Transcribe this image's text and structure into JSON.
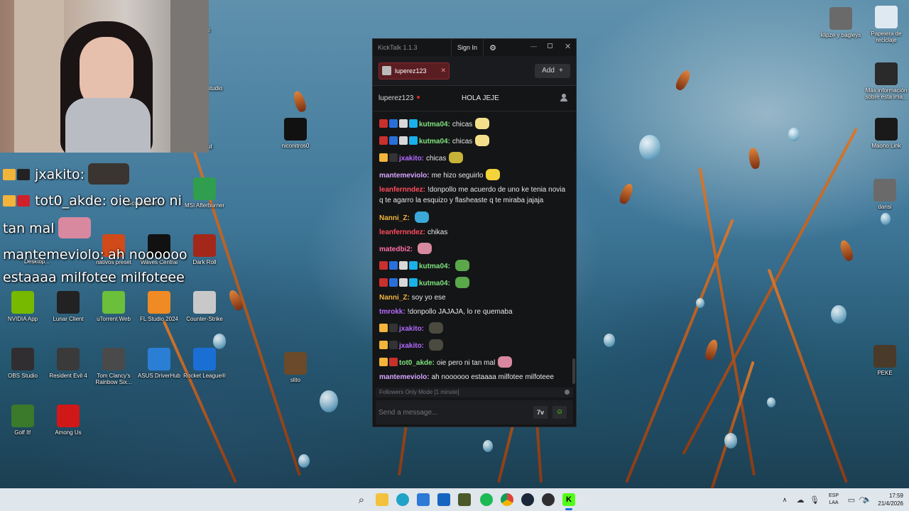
{
  "desktop": {
    "left_icons": [
      {
        "label": "MSI Afterburner",
        "color": "#2f9e4e"
      },
      {
        "label": "nativos preset",
        "color": "#d04a1a"
      },
      {
        "label": "Waves Central",
        "color": "#111111"
      },
      {
        "label": "Dark Roll",
        "color": "#a3281a"
      },
      {
        "label": "NVIDIA App",
        "color": "#76b900"
      },
      {
        "label": "Lunar Client",
        "color": "#222222"
      },
      {
        "label": "uTorrent Web",
        "color": "#6bbf3b"
      },
      {
        "label": "FL Studio 2024",
        "color": "#f08a24"
      },
      {
        "label": "Counter-Strike",
        "color": "#c8c8c8"
      },
      {
        "label": "OBS Studio",
        "color": "#302e31"
      },
      {
        "label": "Resident Evil 4",
        "color": "#3a3a3a"
      },
      {
        "label": "Tom Clancy's Rainbow Six...",
        "color": "#4a4a4a"
      },
      {
        "label": "ASUS DriverHub",
        "color": "#2a7fd4"
      },
      {
        "label": "Rocket League®",
        "color": "#1a6fd4"
      },
      {
        "label": "Golf It!",
        "color": "#3a7a2a"
      },
      {
        "label": "Among Us",
        "color": "#d01818"
      },
      {
        "label": "niconitros0",
        "color": "#111111"
      },
      {
        "label": "slito",
        "color": "#6a4a2a"
      }
    ],
    "partial_labels": [
      "lk",
      "studio",
      "ut",
      "P",
      "Screenshot 2",
      "Desktop..."
    ],
    "right_icons": [
      {
        "label": "klipze y bagleys",
        "color": "#6a6a6a"
      },
      {
        "label": "Papelera de reciclaje",
        "color": "#dfe9f2"
      },
      {
        "label": "Más información sobre esta ima...",
        "color": "#2a2a2a"
      },
      {
        "label": "Maono Link",
        "color": "#1a1a1a"
      },
      {
        "label": "dansi",
        "color": "#6a6a6a"
      },
      {
        "label": "PEKE",
        "color": "#4a3a2a"
      }
    ]
  },
  "stream_overlay": {
    "lines": [
      {
        "user": "jxakito:",
        "text": "",
        "color": "#b56bff"
      },
      {
        "user": "tot0_akde:",
        "text": "oie pero ni",
        "color": "#7ee0d0"
      },
      {
        "user": "",
        "text": "tan mal",
        "color": "#ffffff"
      },
      {
        "user": "mantemeviolo:",
        "text": "ah noooooo",
        "color": "#d7a6ff"
      },
      {
        "user": "",
        "text": "estaaaa milfotee milfoteee",
        "color": "#ffffff"
      }
    ]
  },
  "kicktalk": {
    "title": "KickTalk 1.1.3",
    "sign_in": "Sign In",
    "tab": "luperez123",
    "add_label": "Add",
    "channel": "luperez123",
    "stream_title": "HOLA JEJE",
    "followers_mode": "Followers Only Mode [1 minute]",
    "input_placeholder": "Send a message...",
    "messages": [
      {
        "user": "kutma04:",
        "text": "chicas",
        "color": "#7fe27f",
        "badges": [
          "sub",
          "mod",
          "vip",
          "gift"
        ]
      },
      {
        "user": "kutma04:",
        "text": "chicas",
        "color": "#7fe27f",
        "badges": [
          "sub",
          "mod",
          "vip",
          "gift"
        ]
      },
      {
        "user": "jxakito:",
        "text": "chicas",
        "color": "#b56bff",
        "badges": [
          "crown",
          "glasses"
        ]
      },
      {
        "user": "mantemeviolo:",
        "text": "me hizo seguirlo",
        "color": "#d7a6ff",
        "badges": []
      },
      {
        "user": "leanfernndez:",
        "text": "!donpollo me acuerdo de uno ke tenia novia q te agarro la esquizo y flasheaste q te miraba jajaja",
        "color": "#ff4d5e",
        "badges": []
      },
      {
        "user": "Nanni_Z:",
        "text": "",
        "color": "#f2b43a",
        "badges": []
      },
      {
        "user": "leanfernndez:",
        "text": "chikas",
        "color": "#ff4d5e",
        "badges": []
      },
      {
        "user": "matedbi2:",
        "text": "",
        "color": "#ff6fa8",
        "badges": []
      },
      {
        "user": "kutma04:",
        "text": "",
        "color": "#7fe27f",
        "badges": [
          "sub",
          "mod",
          "vip",
          "gift"
        ]
      },
      {
        "user": "kutma04:",
        "text": "",
        "color": "#7fe27f",
        "badges": [
          "sub",
          "mod",
          "vip",
          "gift"
        ]
      },
      {
        "user": "Nanni_Z:",
        "text": "soy yo ese",
        "color": "#f2b43a",
        "badges": []
      },
      {
        "user": "tmrokk:",
        "text": "!donpollo JAJAJA, lo re quemaba",
        "color": "#b56bff",
        "badges": []
      },
      {
        "user": "jxakito:",
        "text": "",
        "color": "#b56bff",
        "badges": [
          "crown",
          "glasses"
        ]
      },
      {
        "user": "jxakito:",
        "text": "",
        "color": "#b56bff",
        "badges": [
          "crown",
          "glasses"
        ]
      },
      {
        "user": "tot0_akde:",
        "text": "oie pero ni tan mal",
        "color": "#7fe27f",
        "badges": [
          "crown",
          "red"
        ]
      },
      {
        "user": "mantemeviolo:",
        "text": "ah noooooo estaaaa milfotee milfoteee",
        "color": "#d7a6ff",
        "badges": []
      }
    ]
  },
  "taskbar": {
    "lang_top": "ESP",
    "lang_bottom": "LAA",
    "time": "17:59",
    "date": "21/4/2026"
  }
}
